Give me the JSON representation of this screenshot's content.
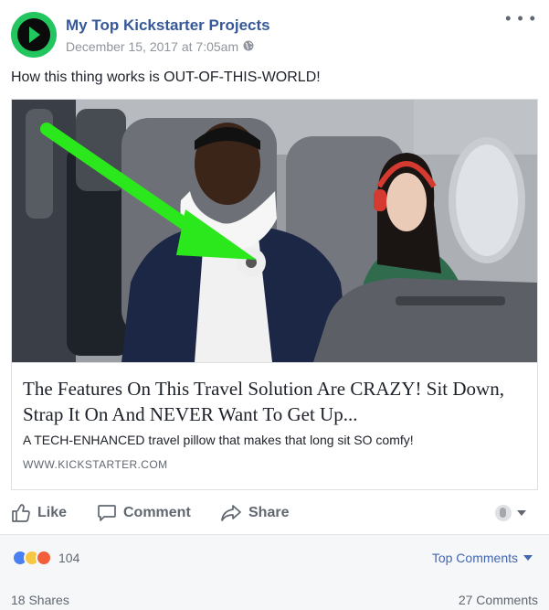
{
  "post": {
    "page_name": "My Top Kickstarter Projects",
    "timestamp": "December 15, 2017 at 7:05am",
    "privacy_icon": "globe-icon",
    "menu_icon": "more-options-icon",
    "text": "How this thing works is OUT-OF-THIS-WORLD!"
  },
  "link_preview": {
    "image": "man sleeping on airplane wearing a white travel pillow, green arrow pointing at pillow",
    "title": "The Features On This Travel Solution Are CRAZY! Sit Down, Strap It On And NEVER Want To Get Up...",
    "description": "A TECH-ENHANCED travel pillow that makes that long sit SO comfy!",
    "domain": "WWW.KICKSTARTER.COM"
  },
  "actions": {
    "like_label": "Like",
    "comment_label": "Comment",
    "share_label": "Share"
  },
  "engagement": {
    "reaction_icons": [
      "like-icon",
      "haha-icon",
      "angry-icon"
    ],
    "reaction_count": "104",
    "top_comments_label": "Top Comments",
    "shares_label": "18 Shares",
    "comments_label": "27 Comments"
  },
  "colors": {
    "link_blue": "#365899",
    "avatar_green": "#22c55e",
    "arrow_green": "#2be81c",
    "secondary_text": "#606770"
  }
}
